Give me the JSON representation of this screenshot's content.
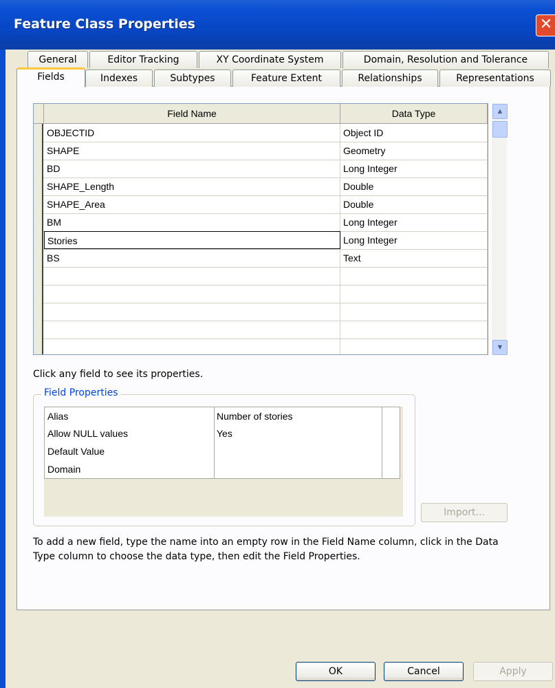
{
  "window": {
    "title": "Feature Class Properties",
    "close_symbol": "✕"
  },
  "tabs_back": [
    "General",
    "Editor Tracking",
    "XY Coordinate System",
    "Domain, Resolution and Tolerance"
  ],
  "tabs_front": [
    "Fields",
    "Indexes",
    "Subtypes",
    "Feature Extent",
    "Relationships",
    "Representations"
  ],
  "active_tab": "Fields",
  "grid": {
    "columns": [
      "Field Name",
      "Data Type"
    ],
    "rows": [
      {
        "name": "OBJECTID",
        "type": "Object ID"
      },
      {
        "name": "SHAPE",
        "type": "Geometry"
      },
      {
        "name": "BD",
        "type": "Long Integer"
      },
      {
        "name": "SHAPE_Length",
        "type": "Double"
      },
      {
        "name": "SHAPE_Area",
        "type": "Double"
      },
      {
        "name": "BM",
        "type": "Long Integer"
      },
      {
        "name": "Stories",
        "type": "Long Integer"
      },
      {
        "name": "BS",
        "type": "Text"
      },
      {
        "name": "",
        "type": ""
      },
      {
        "name": "",
        "type": ""
      },
      {
        "name": "",
        "type": ""
      },
      {
        "name": "",
        "type": ""
      },
      {
        "name": "",
        "type": ""
      }
    ],
    "selected_row": "Stories"
  },
  "hint": "Click any field to see its properties.",
  "field_properties": {
    "title": "Field Properties",
    "rows": [
      {
        "name": "Alias",
        "value": "Number of stories"
      },
      {
        "name": "Allow NULL values",
        "value": "Yes"
      },
      {
        "name": "Default Value",
        "value": ""
      },
      {
        "name": "Domain",
        "value": ""
      }
    ]
  },
  "import_label": "Import...",
  "help_text": "To add a new field, type the name into an empty row in the Field Name column, click in the Data Type column to choose the data type, then edit the Field Properties.",
  "buttons": {
    "ok": "OK",
    "cancel": "Cancel",
    "apply": "Apply"
  }
}
